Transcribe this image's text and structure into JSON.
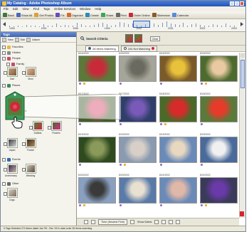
{
  "window": {
    "title": "My Catalog - Adobe Photoshop Album"
  },
  "menu": [
    "File",
    "Edit",
    "View",
    "Find",
    "Tags",
    "Online Services",
    "Window",
    "Help"
  ],
  "toolbar": {
    "back_label": "Back",
    "show_all_label": "Show All",
    "get_photos_label": "Get Photos",
    "fix_label": "Fix",
    "organize_label": "Organize",
    "create_label": "Create",
    "share_label": "Share",
    "print_label": "Print",
    "order_online_label": "Order Online",
    "slideshow_label": "Slideshow",
    "calendar_label": "Calendar"
  },
  "timeline": {
    "years": [
      "1990",
      "1993",
      "1996",
      "1999",
      "2000",
      "2001",
      "2002",
      "2003"
    ],
    "bar_heights": [
      0.2,
      0.1,
      0.3,
      0.15,
      0.4,
      0.2,
      0.3,
      0.1,
      0.5,
      0.3,
      0.2,
      0.6,
      0.3,
      0.4,
      0.2,
      0.3,
      0.7,
      0.5,
      0.3,
      0.2,
      0.4,
      0.6,
      0.8,
      0.5,
      0.3,
      0.4,
      0.9,
      0.7,
      0.5,
      0.6,
      0.4,
      0.3,
      0.5,
      0.7,
      0.6,
      0.4,
      0.8,
      1.0,
      0.6,
      0.5,
      0.4,
      0.7,
      0.3,
      0.5,
      0.6,
      0.4,
      0.3,
      0.2,
      0.5,
      0.4,
      0.3,
      0.6,
      0.2,
      0.3
    ]
  },
  "tags_panel": {
    "header": "Tags",
    "tool_new": "New",
    "tool_edit": "Edit",
    "tool_attach": "Attach",
    "rows": [
      {
        "label": "Favorites"
      },
      {
        "label": "Hidden"
      },
      {
        "label": "People"
      },
      {
        "label": "Family"
      },
      {
        "label": "Places"
      },
      {
        "label": "Friends"
      },
      {
        "label": "Events"
      },
      {
        "label": "Other"
      }
    ],
    "thumbs": [
      {
        "label": "Dad"
      },
      {
        "label": "Mom"
      },
      {
        "label": "Dahlias"
      },
      {
        "label": "Flowers"
      },
      {
        "label": "Japan"
      },
      {
        "label": "France"
      },
      {
        "label": "Anniversary"
      },
      {
        "label": "Wedding"
      },
      {
        "label": "Dogs"
      }
    ]
  },
  "search": {
    "label": "Search Criteria",
    "clear_label": "Clear"
  },
  "match": {
    "matching_label": "28 Items Matching",
    "not_matching_label": "244 Not Matching"
  },
  "photos": [
    {
      "date": "8/16/2002",
      "colors": [
        "#5b7a3a",
        "#c92a3a"
      ]
    },
    {
      "date": "8/16/2002",
      "colors": [
        "#a6a59a",
        "#6b6a60"
      ]
    },
    {
      "date": "8/16/2002",
      "colors": [
        "#7a5a2a",
        "#e8c23a"
      ]
    },
    {
      "date": "8/16/2002",
      "colors": [
        "#4e6b2f",
        "#e8c9a0"
      ]
    },
    {
      "date": "8/17/2002",
      "colors": [
        "#3f5e2a",
        "#d84a6a"
      ]
    },
    {
      "date": "8/17/2002",
      "colors": [
        "#2f3f6a",
        "#7a5ab8"
      ]
    },
    {
      "date": "8/18/2002",
      "colors": [
        "#4a6a2a",
        "#d82a2a"
      ]
    },
    {
      "date": "8/18/2002",
      "colors": [
        "#5a7a3a",
        "#e83a2a"
      ]
    },
    {
      "date": "8/19/2002",
      "colors": [
        "#2e4a1e",
        "#8a9a5a"
      ]
    },
    {
      "date": "8/19/2002",
      "colors": [
        "#8a9ab0",
        "#d8d0c8"
      ]
    },
    {
      "date": "8/19/2002",
      "colors": [
        "#6a8ab8",
        "#e8d8c0"
      ]
    },
    {
      "date": "8/19/2002",
      "colors": [
        "#4a6a9a",
        "#f0f0f0"
      ]
    },
    {
      "date": "8/20/2002",
      "colors": [
        "#8aa0c0",
        "#3a3a3a"
      ]
    },
    {
      "date": "8/20/2002",
      "colors": [
        "#5a7aa8",
        "#e8e0d0"
      ]
    },
    {
      "date": "8/21/2002",
      "colors": [
        "#6a8ab8",
        "#e0b8a8"
      ]
    },
    {
      "date": "8/21/2002",
      "colors": [
        "#3a3a5a",
        "#6a3aa8"
      ]
    }
  ],
  "bottom_bar": {
    "sort_label": "Time (Newest First)",
    "dates_label": "Show Dates"
  },
  "status": {
    "text": "0 Tags Selected    274 Items dated Jan '99 - Dec '02 in date order  28 Items matching"
  },
  "accent": "#2553b8"
}
